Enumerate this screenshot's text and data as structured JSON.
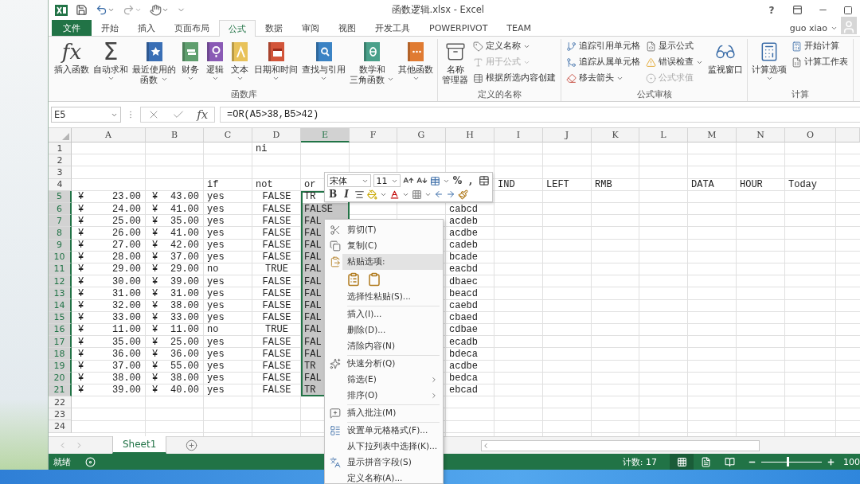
{
  "window": {
    "title": "函数逻辑.xlsx - Excel",
    "help": "?"
  },
  "tabs": [
    {
      "label": "文件",
      "kind": "file",
      "selected": false
    },
    {
      "label": "开始",
      "kind": "tab",
      "selected": false
    },
    {
      "label": "插入",
      "kind": "tab",
      "selected": false
    },
    {
      "label": "页面布局",
      "kind": "tab",
      "selected": false
    },
    {
      "label": "公式",
      "kind": "tab",
      "selected": true
    },
    {
      "label": "数据",
      "kind": "tab",
      "selected": false
    },
    {
      "label": "审阅",
      "kind": "tab",
      "selected": false
    },
    {
      "label": "视图",
      "kind": "tab",
      "selected": false
    },
    {
      "label": "开发工具",
      "kind": "tab",
      "selected": false
    },
    {
      "label": "POWERPIVOT",
      "kind": "tab",
      "selected": false
    },
    {
      "label": "TEAM",
      "kind": "tab",
      "selected": false
    }
  ],
  "account": {
    "user": "guo xiao"
  },
  "ribbon": {
    "groups": [
      {
        "label": "函数库",
        "items": [
          {
            "kind": "large",
            "glyph": "fx",
            "lines": [
              "插入函数"
            ],
            "dropdown": false
          },
          {
            "kind": "large",
            "glyph": "Σ",
            "lines": [
              "自动求和"
            ],
            "dropdown": true
          },
          {
            "kind": "large",
            "lines": [
              "最近使用的",
              "函数"
            ],
            "dropdown": true
          },
          {
            "kind": "large",
            "lines": [
              "财务"
            ],
            "dropdown": true
          },
          {
            "kind": "large",
            "lines": [
              "逻辑"
            ],
            "dropdown": true
          },
          {
            "kind": "large",
            "lines": [
              "文本"
            ],
            "dropdown": true
          },
          {
            "kind": "large",
            "lines": [
              "日期和时间"
            ],
            "dropdown": true
          },
          {
            "kind": "large",
            "lines": [
              "查找与引用"
            ],
            "dropdown": true
          },
          {
            "kind": "large",
            "lines": [
              "数学和",
              "三角函数"
            ],
            "dropdown": true
          },
          {
            "kind": "large",
            "lines": [
              "其他函数"
            ],
            "dropdown": true
          }
        ]
      },
      {
        "label": "定义的名称",
        "items": [
          {
            "kind": "large",
            "lines": [
              "名称",
              "管理器"
            ],
            "dropdown": false
          },
          {
            "kind": "stack",
            "items": [
              {
                "label": "定义名称",
                "dropdown": true,
                "disabled": false
              },
              {
                "label": "用于公式",
                "dropdown": true,
                "disabled": true
              },
              {
                "label": "根据所选内容创建",
                "dropdown": false,
                "disabled": false
              }
            ]
          }
        ]
      },
      {
        "label": "公式审核",
        "items": [
          {
            "kind": "stack",
            "items": [
              {
                "label": "追踪引用单元格",
                "dropdown": false,
                "disabled": false
              },
              {
                "label": "追踪从属单元格",
                "dropdown": false,
                "disabled": false
              },
              {
                "label": "移去箭头",
                "dropdown": true,
                "disabled": false
              }
            ]
          },
          {
            "kind": "stack",
            "items": [
              {
                "label": "显示公式",
                "dropdown": false,
                "disabled": false
              },
              {
                "label": "错误检查",
                "dropdown": true,
                "disabled": false
              },
              {
                "label": "公式求值",
                "dropdown": false,
                "disabled": true
              }
            ]
          },
          {
            "kind": "large",
            "lines": [
              "监视窗口"
            ],
            "dropdown": false
          }
        ]
      },
      {
        "label": "计算",
        "items": [
          {
            "kind": "large",
            "lines": [
              "计算选项"
            ],
            "dropdown": true
          },
          {
            "kind": "stack",
            "items": [
              {
                "label": "开始计算",
                "dropdown": false,
                "disabled": false
              },
              {
                "label": "计算工作表",
                "dropdown": false,
                "disabled": false
              }
            ]
          }
        ]
      }
    ]
  },
  "formula_bar": {
    "name_box": "E5",
    "function_glyph": "fx",
    "formula": "=OR(A5>38,B5>42)"
  },
  "grid": {
    "columns": [
      {
        "letter": "A",
        "selected": false
      },
      {
        "letter": "B",
        "selected": false
      },
      {
        "letter": "C",
        "selected": false
      },
      {
        "letter": "D",
        "selected": false
      },
      {
        "letter": "E",
        "selected": true
      },
      {
        "letter": "F",
        "selected": false
      },
      {
        "letter": "G",
        "selected": false
      },
      {
        "letter": "H",
        "selected": false
      },
      {
        "letter": "I",
        "selected": false
      },
      {
        "letter": "J",
        "selected": false
      },
      {
        "letter": "K",
        "selected": false
      },
      {
        "letter": "L",
        "selected": false
      },
      {
        "letter": "M",
        "selected": false
      },
      {
        "letter": "N",
        "selected": false
      },
      {
        "letter": "O",
        "selected": false
      }
    ],
    "rows": [
      {
        "number": "1",
        "selected": false,
        "cells": {
          "D": "ni"
        }
      },
      {
        "number": "2",
        "selected": false,
        "cells": {}
      },
      {
        "number": "3",
        "selected": false,
        "cells": {}
      },
      {
        "number": "4",
        "selected": false,
        "cells": {
          "C": "if",
          "D": "not",
          "E": "or",
          "I": "IND",
          "J": "LEFT",
          "K": "RMB",
          "M": "DATA",
          "N": "HOUR",
          "O": "Today"
        }
      },
      {
        "number": "5",
        "selected": true,
        "cells": {
          "A": {
            "kind": "currency",
            "symbol": "¥",
            "amount": "23.00"
          },
          "B": {
            "kind": "currency",
            "symbol": "¥",
            "amount": "43.00"
          },
          "C": "yes",
          "D": {
            "kind": "logical",
            "value": "FALSE"
          },
          "E": "TR"
        }
      },
      {
        "number": "6",
        "selected": true,
        "cells": {
          "A": {
            "kind": "currency",
            "symbol": "¥",
            "amount": "24.00"
          },
          "B": {
            "kind": "currency",
            "symbol": "¥",
            "amount": "41.00"
          },
          "C": "yes",
          "D": {
            "kind": "logical",
            "value": "FALSE"
          },
          "E": "FALSE",
          "H": "cabcd"
        }
      },
      {
        "number": "7",
        "selected": true,
        "cells": {
          "A": {
            "kind": "currency",
            "symbol": "¥",
            "amount": "25.00"
          },
          "B": {
            "kind": "currency",
            "symbol": "¥",
            "amount": "35.00"
          },
          "C": "yes",
          "D": {
            "kind": "logical",
            "value": "FALSE"
          },
          "E": "FAL",
          "H": "acdeb"
        }
      },
      {
        "number": "8",
        "selected": true,
        "cells": {
          "A": {
            "kind": "currency",
            "symbol": "¥",
            "amount": "26.00"
          },
          "B": {
            "kind": "currency",
            "symbol": "¥",
            "amount": "41.00"
          },
          "C": "yes",
          "D": {
            "kind": "logical",
            "value": "FALSE"
          },
          "E": "FAL",
          "H": "acdbe"
        }
      },
      {
        "number": "9",
        "selected": true,
        "cells": {
          "A": {
            "kind": "currency",
            "symbol": "¥",
            "amount": "27.00"
          },
          "B": {
            "kind": "currency",
            "symbol": "¥",
            "amount": "42.00"
          },
          "C": "yes",
          "D": {
            "kind": "logical",
            "value": "FALSE"
          },
          "E": "FAL",
          "H": "cadeb"
        }
      },
      {
        "number": "10",
        "selected": true,
        "cells": {
          "A": {
            "kind": "currency",
            "symbol": "¥",
            "amount": "28.00"
          },
          "B": {
            "kind": "currency",
            "symbol": "¥",
            "amount": "37.00"
          },
          "C": "yes",
          "D": {
            "kind": "logical",
            "value": "FALSE"
          },
          "E": "FAL",
          "H": "bcade"
        }
      },
      {
        "number": "11",
        "selected": true,
        "cells": {
          "A": {
            "kind": "currency",
            "symbol": "¥",
            "amount": "29.00"
          },
          "B": {
            "kind": "currency",
            "symbol": "¥",
            "amount": "29.00"
          },
          "C": "no",
          "D": {
            "kind": "logical",
            "value": "TRUE"
          },
          "E": "FAL",
          "H": "eacbd"
        }
      },
      {
        "number": "12",
        "selected": true,
        "cells": {
          "A": {
            "kind": "currency",
            "symbol": "¥",
            "amount": "30.00"
          },
          "B": {
            "kind": "currency",
            "symbol": "¥",
            "amount": "39.00"
          },
          "C": "yes",
          "D": {
            "kind": "logical",
            "value": "FALSE"
          },
          "E": "FAL",
          "H": "dbaec"
        }
      },
      {
        "number": "13",
        "selected": true,
        "cells": {
          "A": {
            "kind": "currency",
            "symbol": "¥",
            "amount": "31.00"
          },
          "B": {
            "kind": "currency",
            "symbol": "¥",
            "amount": "31.00"
          },
          "C": "yes",
          "D": {
            "kind": "logical",
            "value": "FALSE"
          },
          "E": "FAL",
          "H": "beacd"
        }
      },
      {
        "number": "14",
        "selected": true,
        "cells": {
          "A": {
            "kind": "currency",
            "symbol": "¥",
            "amount": "32.00"
          },
          "B": {
            "kind": "currency",
            "symbol": "¥",
            "amount": "38.00"
          },
          "C": "yes",
          "D": {
            "kind": "logical",
            "value": "FALSE"
          },
          "E": "FAL",
          "H": "caebd"
        }
      },
      {
        "number": "15",
        "selected": true,
        "cells": {
          "A": {
            "kind": "currency",
            "symbol": "¥",
            "amount": "33.00"
          },
          "B": {
            "kind": "currency",
            "symbol": "¥",
            "amount": "33.00"
          },
          "C": "yes",
          "D": {
            "kind": "logical",
            "value": "FALSE"
          },
          "E": "FAL",
          "H": "cbaed"
        }
      },
      {
        "number": "16",
        "selected": true,
        "cells": {
          "A": {
            "kind": "currency",
            "symbol": "¥",
            "amount": "11.00"
          },
          "B": {
            "kind": "currency",
            "symbol": "¥",
            "amount": "11.00"
          },
          "C": "no",
          "D": {
            "kind": "logical",
            "value": "TRUE"
          },
          "E": "FAL",
          "H": "cdbae"
        }
      },
      {
        "number": "17",
        "selected": true,
        "cells": {
          "A": {
            "kind": "currency",
            "symbol": "¥",
            "amount": "35.00"
          },
          "B": {
            "kind": "currency",
            "symbol": "¥",
            "amount": "25.00"
          },
          "C": "yes",
          "D": {
            "kind": "logical",
            "value": "FALSE"
          },
          "E": "FAL",
          "H": "ecadb"
        }
      },
      {
        "number": "18",
        "selected": true,
        "cells": {
          "A": {
            "kind": "currency",
            "symbol": "¥",
            "amount": "36.00"
          },
          "B": {
            "kind": "currency",
            "symbol": "¥",
            "amount": "36.00"
          },
          "C": "yes",
          "D": {
            "kind": "logical",
            "value": "FALSE"
          },
          "E": "FAL",
          "H": "bdeca"
        }
      },
      {
        "number": "19",
        "selected": true,
        "cells": {
          "A": {
            "kind": "currency",
            "symbol": "¥",
            "amount": "37.00"
          },
          "B": {
            "kind": "currency",
            "symbol": "¥",
            "amount": "55.00"
          },
          "C": "yes",
          "D": {
            "kind": "logical",
            "value": "FALSE"
          },
          "E": "TR",
          "H": "acdbe"
        }
      },
      {
        "number": "20",
        "selected": true,
        "cells": {
          "A": {
            "kind": "currency",
            "symbol": "¥",
            "amount": "38.00"
          },
          "B": {
            "kind": "currency",
            "symbol": "¥",
            "amount": "38.00"
          },
          "C": "yes",
          "D": {
            "kind": "logical",
            "value": "FALSE"
          },
          "E": "FAL",
          "H": "bedca"
        }
      },
      {
        "number": "21",
        "selected": true,
        "cells": {
          "A": {
            "kind": "currency",
            "symbol": "¥",
            "amount": "39.00"
          },
          "B": {
            "kind": "currency",
            "symbol": "¥",
            "amount": "40.00"
          },
          "C": "yes",
          "D": {
            "kind": "logical",
            "value": "FALSE"
          },
          "E": "TR",
          "H": "ebcad"
        }
      },
      {
        "number": "22",
        "selected": false,
        "cells": {}
      },
      {
        "number": "23",
        "selected": false,
        "cells": {}
      },
      {
        "number": "24",
        "selected": false,
        "cells": {}
      }
    ]
  },
  "mini_toolbar": {
    "font": "宋体",
    "size": "11",
    "percent": "%",
    "comma": ",",
    "bold": "B",
    "italic": "I"
  },
  "context_menu": {
    "items": [
      {
        "kind": "item",
        "label": "剪切(T)",
        "highlighted": false,
        "submenu": false
      },
      {
        "kind": "item",
        "label": "复制(C)",
        "highlighted": false,
        "submenu": false
      },
      {
        "kind": "header",
        "label": "粘贴选项:",
        "highlighted": true
      },
      {
        "kind": "paste_options"
      },
      {
        "kind": "item",
        "label": "选择性粘贴(S)...",
        "highlighted": false,
        "submenu": false
      },
      {
        "kind": "separator"
      },
      {
        "kind": "item",
        "label": "插入(I)...",
        "highlighted": false,
        "submenu": false
      },
      {
        "kind": "item",
        "label": "删除(D)...",
        "highlighted": false,
        "submenu": false
      },
      {
        "kind": "item",
        "label": "清除内容(N)",
        "highlighted": false,
        "submenu": false
      },
      {
        "kind": "separator"
      },
      {
        "kind": "item",
        "label": "快速分析(Q)",
        "highlighted": false,
        "submenu": false
      },
      {
        "kind": "item",
        "label": "筛选(E)",
        "highlighted": false,
        "submenu": true
      },
      {
        "kind": "item",
        "label": "排序(O)",
        "highlighted": false,
        "submenu": true
      },
      {
        "kind": "separator"
      },
      {
        "kind": "item",
        "label": "插入批注(M)",
        "highlighted": false,
        "submenu": false
      },
      {
        "kind": "separator"
      },
      {
        "kind": "item",
        "label": "设置单元格格式(F)...",
        "highlighted": false,
        "submenu": false
      },
      {
        "kind": "item",
        "label": "从下拉列表中选择(K)...",
        "highlighted": false,
        "submenu": false
      },
      {
        "kind": "item",
        "label": "显示拼音字段(S)",
        "highlighted": false,
        "submenu": false
      },
      {
        "kind": "item",
        "label": "定义名称(A)...",
        "highlighted": false,
        "submenu": false
      }
    ]
  },
  "sheet_tabs": [
    {
      "label": "Sheet1",
      "selected": true
    }
  ],
  "status_bar": {
    "status": "就绪",
    "count": "计数: 17",
    "views": [
      {
        "selected": true
      },
      {
        "selected": false
      },
      {
        "selected": false
      }
    ],
    "zoom": {
      "level": 0.43,
      "reading": "100"
    }
  }
}
